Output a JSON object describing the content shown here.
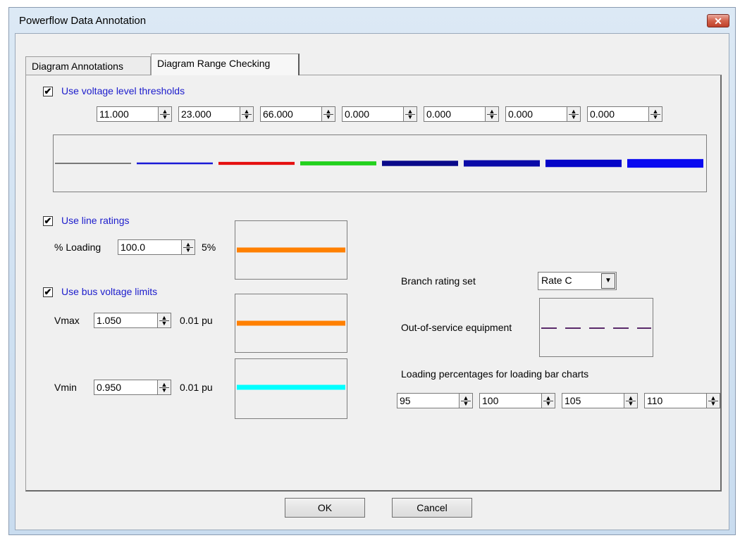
{
  "window": {
    "title": "Powerflow Data Annotation",
    "close_glyph": "✕"
  },
  "tabs": [
    {
      "label": "Diagram Annotations"
    },
    {
      "label": "Diagram Range Checking"
    }
  ],
  "voltage_levels": {
    "checkbox_label": "Use voltage level thresholds",
    "checked": true,
    "thresholds": [
      "11.000",
      "23.000",
      "66.000",
      "0.000",
      "0.000",
      "0.000",
      "0.000"
    ],
    "line_colors": [
      "#000000",
      "#1a1ad6",
      "#e51010",
      "#22d11d",
      "#0a0a8a",
      "#0a0aa8",
      "#0505c8",
      "#0a0af0"
    ]
  },
  "line_ratings": {
    "checkbox_label": "Use line ratings",
    "checked": true,
    "loading_label": "% Loading",
    "loading_value": "100.0",
    "step_label": "5%",
    "preview_color": "#ff8000"
  },
  "bus_voltage": {
    "checkbox_label": "Use bus voltage limits",
    "checked": true,
    "vmax_label": "Vmax",
    "vmax_value": "1.050",
    "vmax_step": "0.01 pu",
    "vmax_color": "#ff8000",
    "vmin_label": "Vmin",
    "vmin_value": "0.950",
    "vmin_step": "0.01 pu",
    "vmin_color": "#00ffff"
  },
  "branch": {
    "rating_set_label": "Branch rating set",
    "rating_set_value": "Rate C",
    "out_of_service_label": "Out-of-service equipment",
    "out_of_service_color": "#5a2a6a",
    "loading_pct_label": "Loading percentages for loading bar charts",
    "loading_pcts": [
      "95",
      "100",
      "105",
      "110"
    ]
  },
  "buttons": {
    "ok": "OK",
    "cancel": "Cancel"
  }
}
